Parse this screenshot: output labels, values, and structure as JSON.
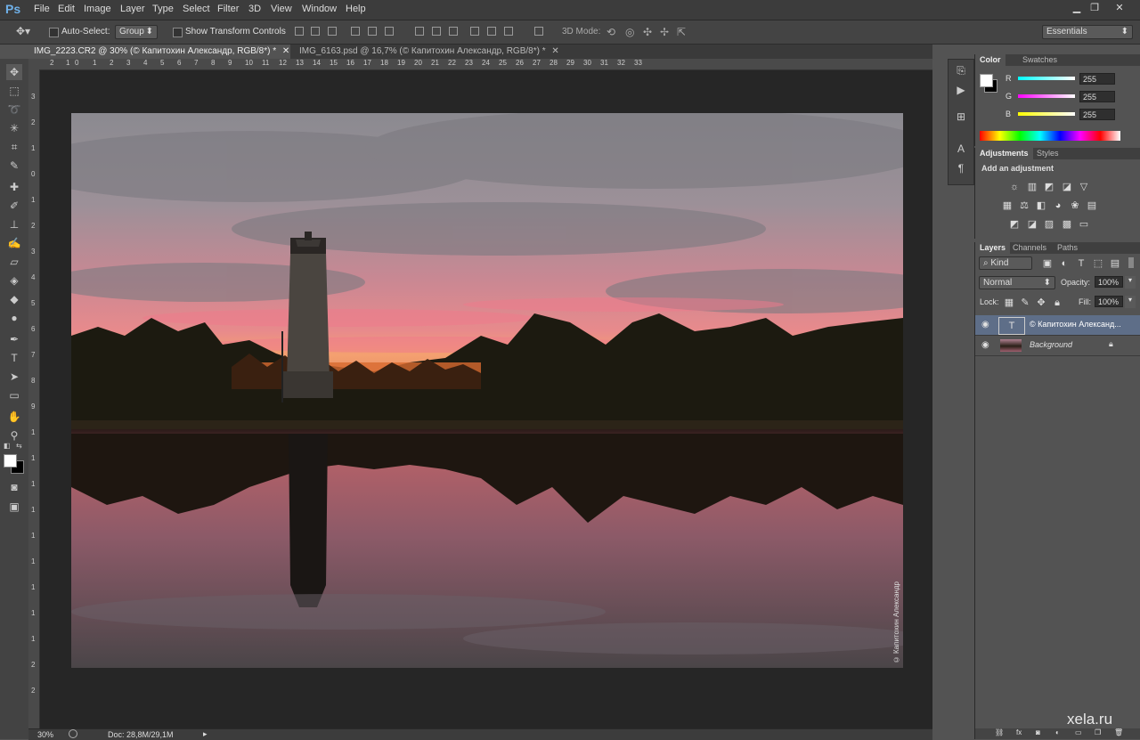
{
  "app": {
    "logo": "Ps"
  },
  "menu": [
    "File",
    "Edit",
    "Image",
    "Layer",
    "Type",
    "Select",
    "Filter",
    "3D",
    "View",
    "Window",
    "Help"
  ],
  "window_controls": {
    "minimize": "▁",
    "restore": "❐",
    "close": "✕"
  },
  "options": {
    "auto_select_label": "Auto-Select:",
    "auto_select_value": "Group",
    "transform_label": "Show Transform Controls",
    "mode_label": "3D Mode:",
    "workspace": "Essentials"
  },
  "tabs": [
    {
      "label": "IMG_2223.CR2 @ 30% (© Капитохин Александр, RGB/8*) *",
      "active": true
    },
    {
      "label": "IMG_6163.psd @ 16,7% (© Капитохин Александр, RGB/8*) *",
      "active": false
    }
  ],
  "ruler_h": [
    "2",
    "1",
    "0",
    "1",
    "2",
    "3",
    "4",
    "5",
    "6",
    "7",
    "8",
    "9",
    "10",
    "11",
    "12",
    "13",
    "14",
    "15",
    "16",
    "17",
    "18",
    "19",
    "20",
    "21",
    "22",
    "23",
    "24",
    "25",
    "26",
    "27",
    "28",
    "29",
    "30",
    "31",
    "32",
    "33"
  ],
  "ruler_v": [
    "3",
    "2",
    "1",
    "0",
    "1",
    "2",
    "3",
    "4",
    "5",
    "6",
    "7",
    "8",
    "9",
    "1",
    "1",
    "1",
    "1",
    "1",
    "1",
    "1",
    "1",
    "1",
    "2",
    "2"
  ],
  "status": {
    "zoom": "30%",
    "doc": "Doc: 28,8M/29,1M"
  },
  "photo": {
    "credit": "© Капитохин Александр"
  },
  "color_panel": {
    "tabs": [
      "Color",
      "Swatches"
    ],
    "channels": [
      {
        "label": "R",
        "value": "255"
      },
      {
        "label": "G",
        "value": "255"
      },
      {
        "label": "B",
        "value": "255"
      }
    ]
  },
  "adjustments_panel": {
    "tabs": [
      "Adjustments",
      "Styles"
    ],
    "heading": "Add an adjustment"
  },
  "layers_panel": {
    "tabs": [
      "Layers",
      "Channels",
      "Paths"
    ],
    "kind": "Kind",
    "blend_mode": "Normal",
    "opacity_label": "Opacity:",
    "opacity": "100%",
    "lock_label": "Lock:",
    "fill_label": "Fill:",
    "fill": "100%",
    "layers": [
      {
        "name": "© Капитохин Александ...",
        "type": "text",
        "selected": true
      },
      {
        "name": "Background",
        "type": "image",
        "selected": false
      }
    ]
  },
  "watermark": "xela.ru"
}
